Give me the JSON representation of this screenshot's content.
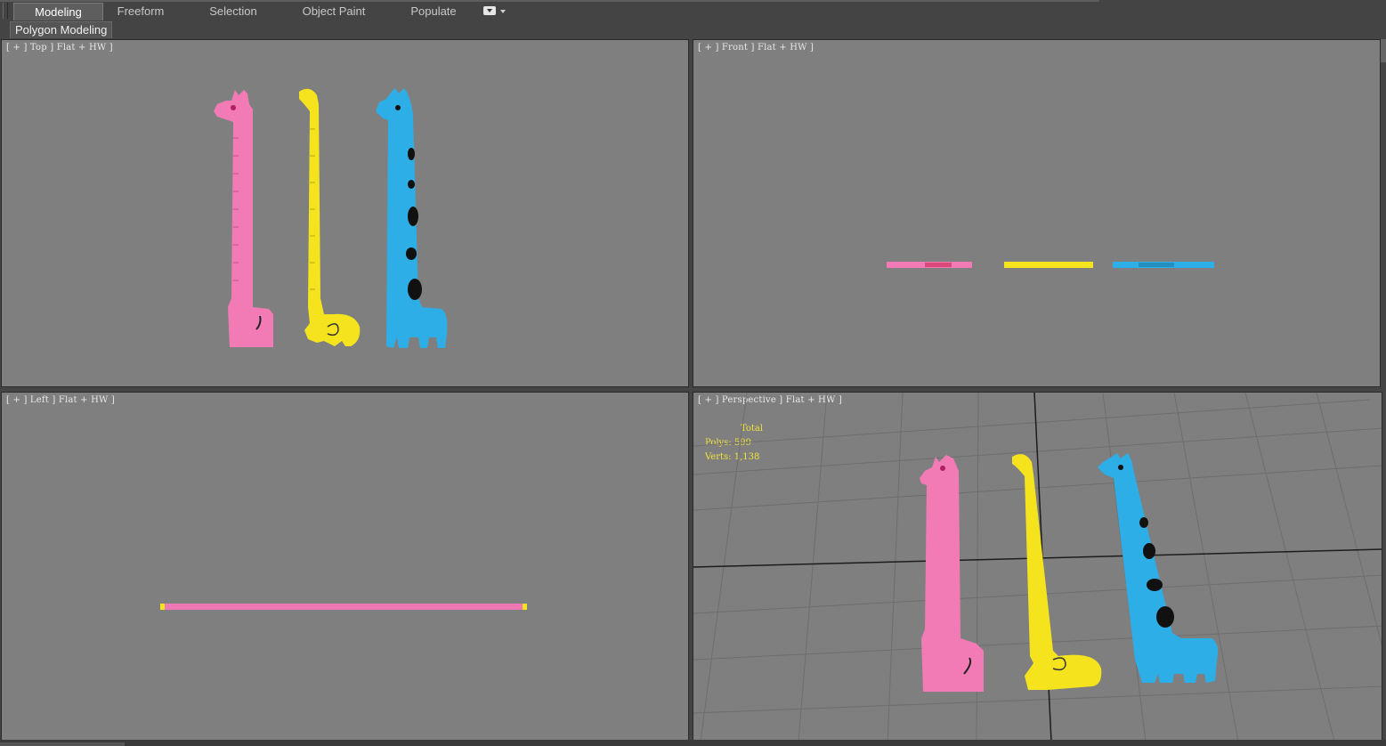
{
  "ribbon": {
    "tabs": [
      {
        "label": "Modeling",
        "active": true
      },
      {
        "label": "Freeform",
        "active": false
      },
      {
        "label": "Selection",
        "active": false
      },
      {
        "label": "Object Paint",
        "active": false
      },
      {
        "label": "Populate",
        "active": false
      }
    ],
    "panel_label": "Polygon Modeling"
  },
  "viewports": {
    "top": {
      "label": "[ + ] Top ] Flat + HW ]"
    },
    "front": {
      "label": "[ + ] Front ] Flat + HW ]"
    },
    "left": {
      "label": "[ + ] Left ] Flat + HW ]"
    },
    "perspective": {
      "label": "[ + ] Perspective ] Flat + HW ]",
      "stats": {
        "title": "Total",
        "polys": "Polys: 599",
        "verts": "Verts: 1,138"
      }
    }
  },
  "colors": {
    "viewport_bg": "#7f7f7f",
    "ui_bg": "#444444",
    "pink_ruler": "#f27bb5",
    "yellow_ruler": "#f5e31e",
    "blue_ruler": "#2eaee6",
    "stats_text": "#f2e23a"
  },
  "icons": [
    "dropdown-menu-icon"
  ]
}
